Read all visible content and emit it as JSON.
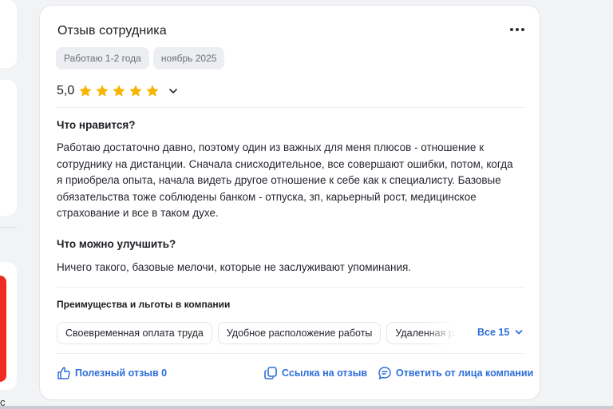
{
  "review": {
    "title": "Отзыв сотрудника",
    "tags": [
      "Работаю 1-2 года",
      "ноябрь 2025"
    ],
    "rating": "5,0",
    "stars": 5,
    "likes_title": "Что нравится?",
    "likes_text": "Работаю достаточно давно, поэтому один из важных для меня плюсов - отношение к сотруднику на дистанции. Сначала снисходительное, все совершают ошибки, потом, когда я приобрела опыта, начала видеть другое отношение к себе как к специалисту. Базовые обязательства тоже соблюдены банком - отпуска, зп, карьерный рост, медицинское страхование и все в таком духе.",
    "improve_title": "Что можно улучшить?",
    "improve_text": "Ничего такого, базовые мелочи, которые не заслуживают упоминания.",
    "benefits_title": "Преимущества и льготы в компании",
    "benefits": [
      "Своевременная оплата труда",
      "Удобное расположение работы",
      "Удаленная работа"
    ],
    "benefits_all": "Все 15",
    "actions": {
      "helpful": "Полезный отзыв 0",
      "link": "Ссылка на отзыв",
      "reply": "Ответить от лица компании"
    }
  },
  "left_column": {
    "partial_text": "с"
  },
  "colors": {
    "accent": "#2d6ed8",
    "star": "#f7b500",
    "chip_bg": "#edeef2",
    "red_block": "#f02b1f"
  },
  "icons": [
    "more-dots-icon",
    "star-icon",
    "chevron-down-icon",
    "thumbs-up-icon",
    "copy-link-icon",
    "chat-reply-icon"
  ]
}
